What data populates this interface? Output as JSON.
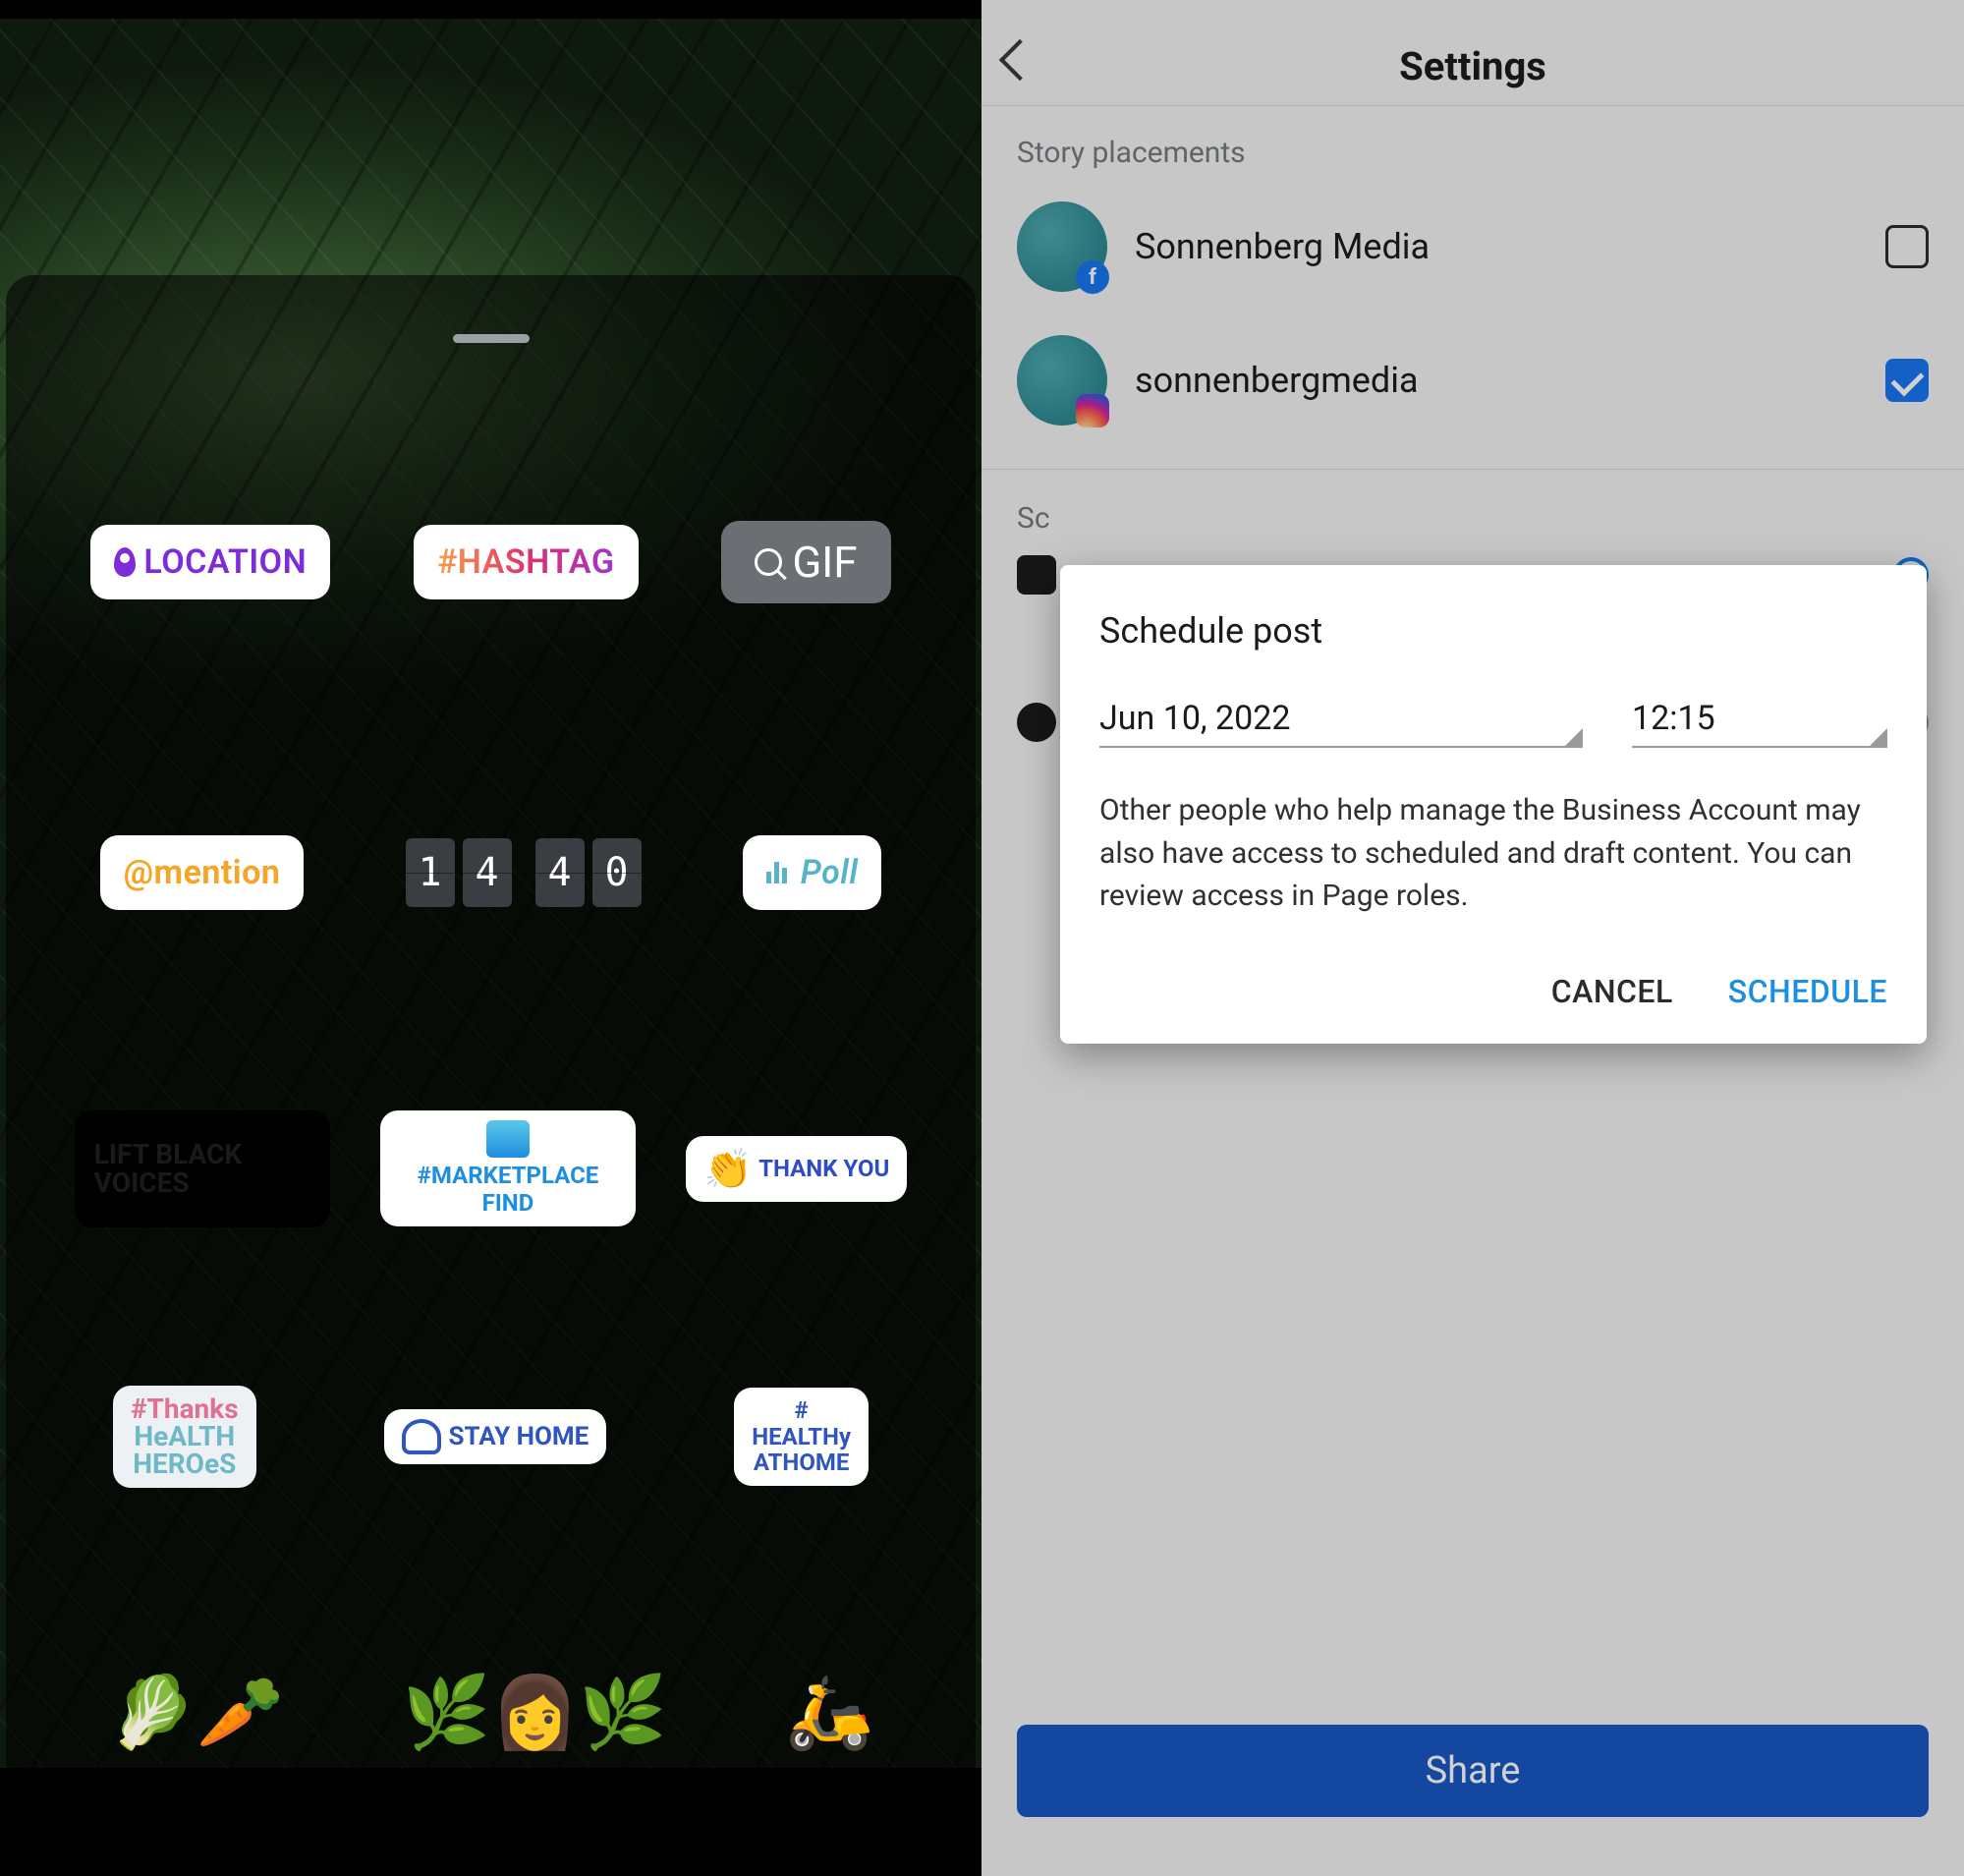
{
  "left": {
    "stickers": {
      "location": "LOCATION",
      "hashtag": "#HASHTAG",
      "gif": "GIF",
      "mention": "@mention",
      "clock": [
        "1",
        "4",
        "4",
        "0"
      ],
      "poll": "Poll",
      "lift_black_voices": "LIFT BLACK VOICES",
      "marketplace": "#MARKETPLACE FIND",
      "thank_you": "THANK YOU",
      "thanks_health_heroes_1": "#Thanks",
      "thanks_health_heroes_2": "HeALTH",
      "thanks_health_heroes_3": "HEROeS",
      "stay_home": "STAY HOME",
      "healthy_at_home_1": "#",
      "healthy_at_home_2": "HEALTHy",
      "healthy_at_home_3": "ATHOME"
    }
  },
  "right": {
    "header": {
      "title": "Settings"
    },
    "section_label": "Story placements",
    "accounts": [
      {
        "name": "Sonnenberg Media",
        "platform": "facebook",
        "checked": false
      },
      {
        "name": "sonnenbergmedia",
        "platform": "instagram",
        "checked": true
      }
    ],
    "peek_label": "Sc",
    "dialog": {
      "title": "Schedule post",
      "date": "Jun 10, 2022",
      "time": "12:15",
      "note": "Other people who help manage the  Business Account may also have access to scheduled and draft content. You can review access in Page roles.",
      "cancel": "CANCEL",
      "schedule": "SCHEDULE"
    },
    "share": "Share"
  }
}
